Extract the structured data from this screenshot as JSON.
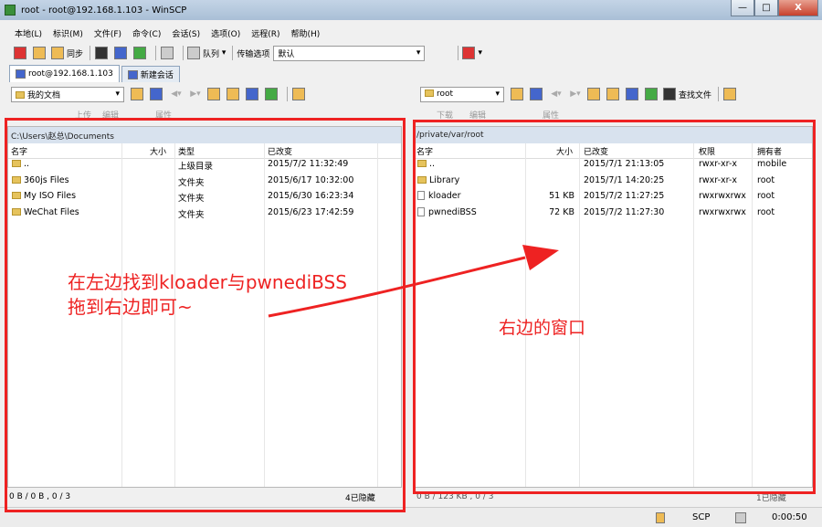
{
  "window": {
    "title": "root - root@192.168.1.103 - WinSCP",
    "min": "—",
    "max": "□",
    "close": "X"
  },
  "menu": [
    "本地(L)",
    "标识(M)",
    "文件(F)",
    "命令(C)",
    "会话(S)",
    "选项(O)",
    "远程(R)",
    "帮助(H)"
  ],
  "toolbar": {
    "sync_label": "同步",
    "queue_label": "队列",
    "transfer_label": "传输选项",
    "transfer_value": "默认"
  },
  "tabs": [
    {
      "label": "root@192.168.1.103",
      "active": true
    },
    {
      "label": "新建会话",
      "active": false
    }
  ],
  "left": {
    "location": "我的文档",
    "toolbar": [
      "上传",
      "编辑",
      "属性"
    ],
    "path": "C:\\Users\\赵总\\Documents",
    "columns": [
      "名字",
      "大小",
      "类型",
      "已改变"
    ],
    "rows": [
      {
        "icon": "parent",
        "name": "..",
        "size": "",
        "type": "上级目录",
        "changed": "2015/7/2  11:32:49"
      },
      {
        "icon": "folder",
        "name": "360js Files",
        "size": "",
        "type": "文件夹",
        "changed": "2015/6/17  10:32:00"
      },
      {
        "icon": "folder",
        "name": "My ISO Files",
        "size": "",
        "type": "文件夹",
        "changed": "2015/6/30  16:23:34"
      },
      {
        "icon": "folder",
        "name": "WeChat Files",
        "size": "",
        "type": "文件夹",
        "changed": "2015/6/23  17:42:59"
      }
    ],
    "status_left": "0 B / 0 B , 0 / 3",
    "status_right": "4已隐藏"
  },
  "right": {
    "location": "root",
    "find_label": "查找文件",
    "toolbar": [
      "下载",
      "编辑",
      "属性"
    ],
    "path": "/private/var/root",
    "columns": [
      "名字",
      "大小",
      "已改变",
      "权限",
      "拥有者"
    ],
    "rows": [
      {
        "icon": "parent",
        "name": "..",
        "size": "",
        "changed": "2015/7/1 21:13:05",
        "rights": "rwxr-xr-x",
        "owner": "mobile"
      },
      {
        "icon": "folder",
        "name": "Library",
        "size": "",
        "changed": "2015/7/1 14:20:25",
        "rights": "rwxr-xr-x",
        "owner": "root"
      },
      {
        "icon": "file",
        "name": "kloader",
        "size": "51 KB",
        "changed": "2015/7/2 11:27:25",
        "rights": "rwxrwxrwx",
        "owner": "root"
      },
      {
        "icon": "file",
        "name": "pwnediBSS",
        "size": "72 KB",
        "changed": "2015/7/2 11:27:30",
        "rights": "rwxrwxrwx",
        "owner": "root"
      }
    ],
    "status_left": "0 B / 123 KB , 0 / 3",
    "status_right": "1已隐藏"
  },
  "bottom": {
    "protocol": "SCP",
    "time": "0:00:50"
  },
  "annotations": {
    "left_line1": "在左边找到kloader与pwnediBSS",
    "left_line2": "拖到右边即可~",
    "right_text": "右边的窗口"
  },
  "colors": {
    "annotation": "#ee2222",
    "panel_title_bg": "#d8e2ee"
  }
}
